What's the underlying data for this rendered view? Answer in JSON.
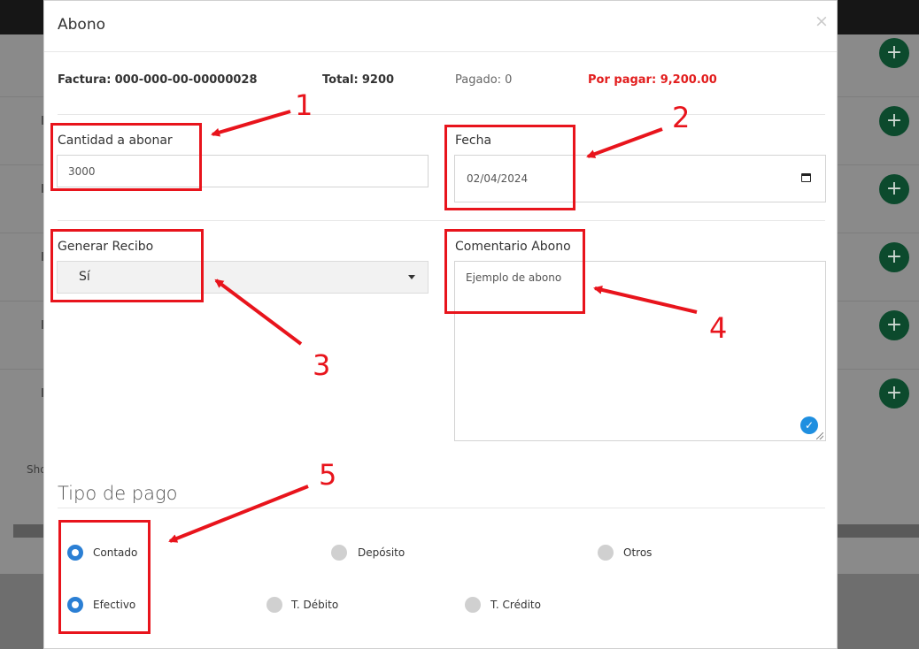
{
  "modal": {
    "title": "Abono",
    "close_glyph": "×"
  },
  "invoice": {
    "factura_label": "Factura:",
    "factura_value": "000-000-00-00000028",
    "total_label": "Total:",
    "total_value": "9200",
    "pagado_label": "Pagado:",
    "pagado_value": "0",
    "por_pagar_label": "Por pagar:",
    "por_pagar_value": "9,200.00"
  },
  "form": {
    "cantidad_label": "Cantidad a abonar",
    "cantidad_value": "3000",
    "fecha_label": "Fecha",
    "fecha_value": "02/04/2024",
    "generar_label": "Generar Recibo",
    "generar_value": "Sí",
    "comentario_label": "Comentario Abono",
    "comentario_value": "Ejemplo de abono"
  },
  "tipo_pago": {
    "title": "Tipo de pago",
    "options_row1": [
      {
        "label": "Contado",
        "selected": true
      },
      {
        "label": "Depósito",
        "selected": false
      },
      {
        "label": "Otros",
        "selected": false
      }
    ],
    "options_row2": [
      {
        "label": "Efectivo",
        "selected": true
      },
      {
        "label": "T. Débito",
        "selected": false
      },
      {
        "label": "T. Crédito",
        "selected": false
      }
    ]
  },
  "background": {
    "show_text": "Sho",
    "plus_glyph": "+"
  },
  "annotations": [
    "1",
    "2",
    "3",
    "4",
    "5"
  ],
  "colors": {
    "annotation": "#e8141c",
    "due": "#e21d1d",
    "radio_selected": "#2b7fd4",
    "plus_button": "#0c4a2d"
  }
}
